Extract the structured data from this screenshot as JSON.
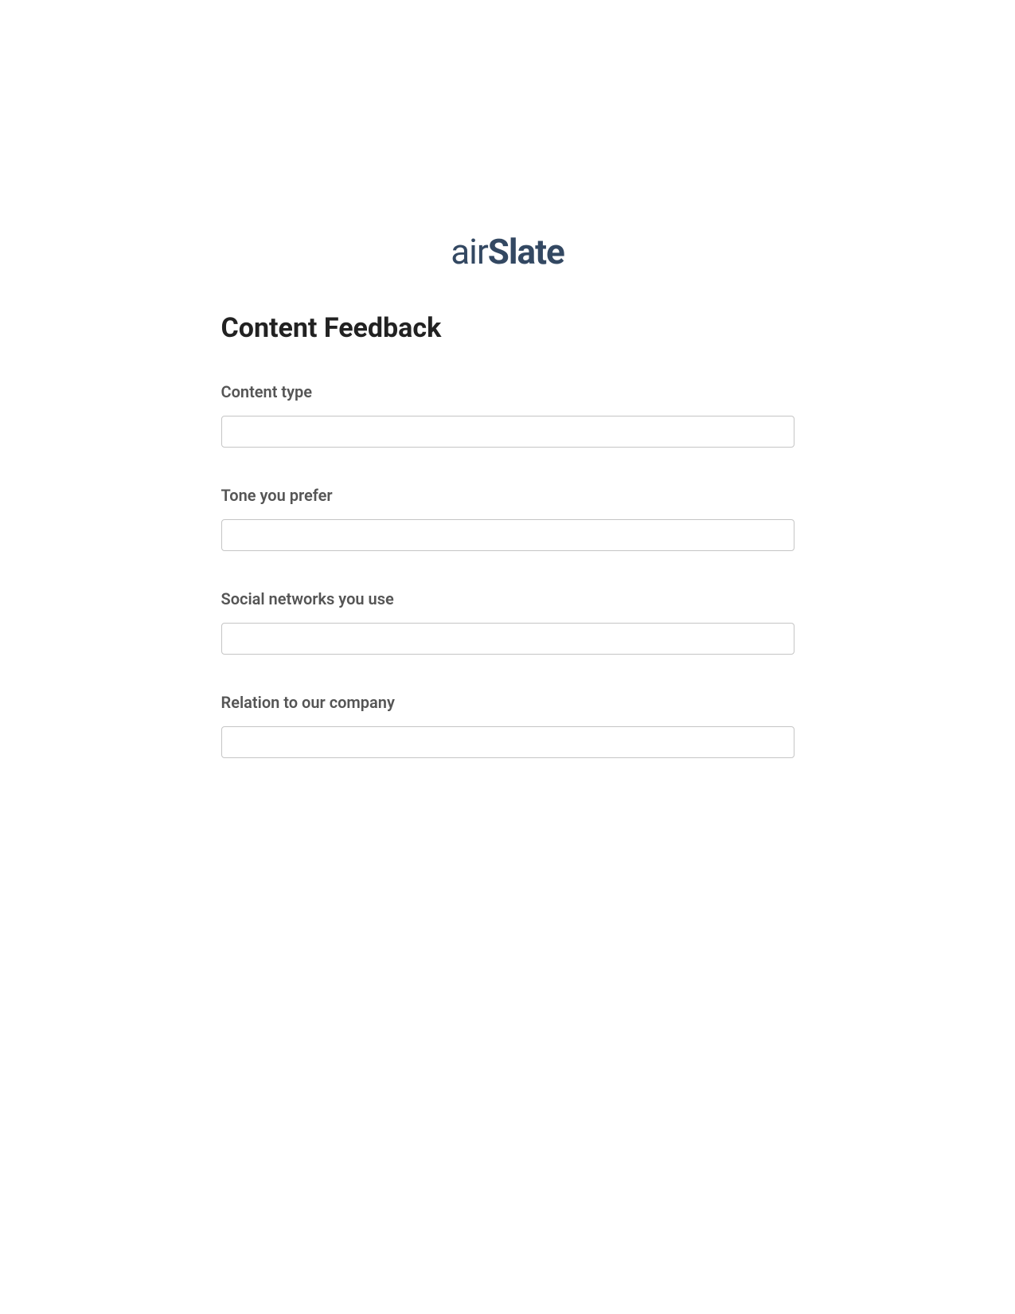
{
  "logo": {
    "prefix": "air",
    "suffix": "Slate"
  },
  "form": {
    "title": "Content Feedback",
    "fields": [
      {
        "label": "Content type",
        "value": ""
      },
      {
        "label": "Tone you prefer",
        "value": ""
      },
      {
        "label": "Social networks you use",
        "value": ""
      },
      {
        "label": "Relation to our company",
        "value": ""
      }
    ]
  }
}
